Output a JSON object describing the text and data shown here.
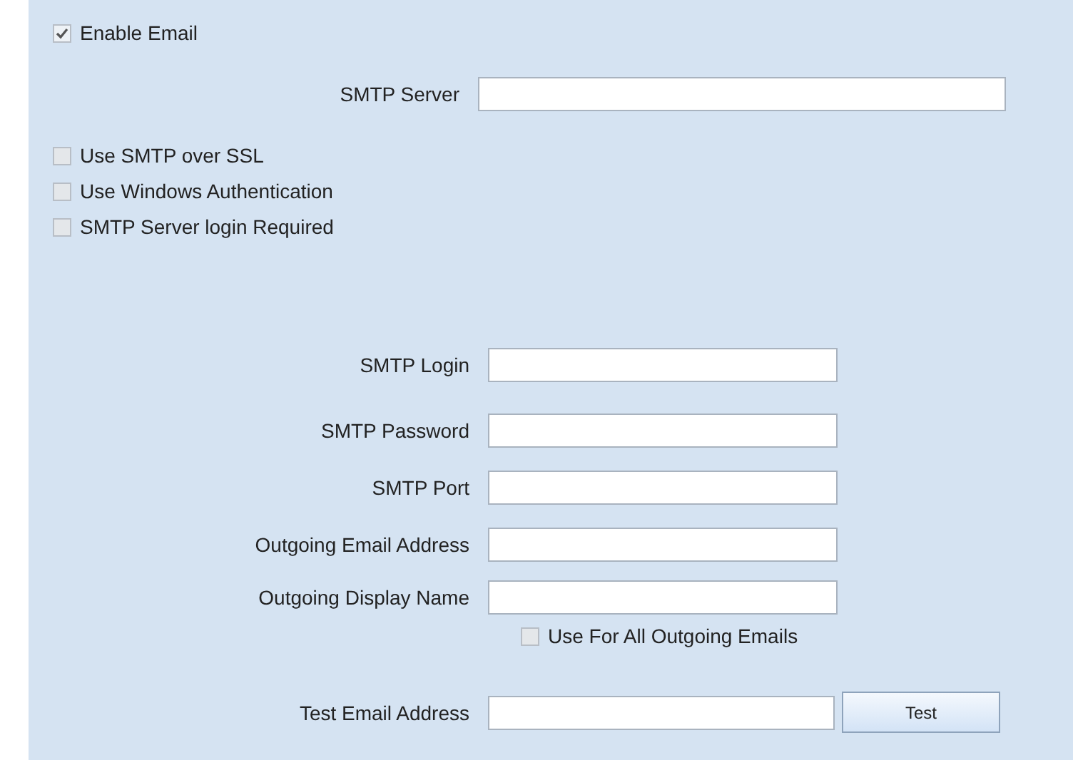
{
  "enable_email": {
    "label": "Enable Email",
    "checked": true
  },
  "smtp_server": {
    "label": "SMTP Server"
  },
  "options": [
    {
      "label": "Use SMTP over SSL",
      "checked": false
    },
    {
      "label": "Use Windows Authentication",
      "checked": false
    },
    {
      "label": "SMTP Server login Required",
      "checked": false
    }
  ],
  "fields": [
    {
      "label": "SMTP Login"
    },
    {
      "label": "SMTP Password"
    },
    {
      "label": "SMTP Port"
    },
    {
      "label": "Outgoing Email Address"
    },
    {
      "label": "Outgoing Display Name"
    }
  ],
  "use_for_all": {
    "label": "Use For All Outgoing Emails",
    "checked": false
  },
  "test_email": {
    "label": "Test Email Address"
  },
  "test_button": "Test"
}
